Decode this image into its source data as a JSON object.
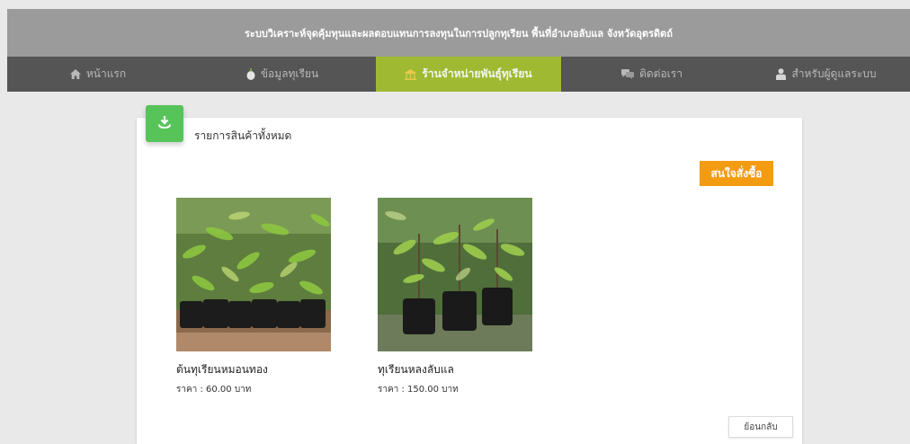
{
  "header": {
    "title": "ระบบวิเคราะห์จุดคุ้มทุนและผลตอบแทนการลงทุนในการปลูกทุเรียน พื้นที่อำเภอลับแล จังหวัดอุตรดิตถ์"
  },
  "nav": {
    "items": [
      {
        "label": "หน้าแรก",
        "icon": "home-icon"
      },
      {
        "label": "ข้อมูลทุเรียน",
        "icon": "durian-icon"
      },
      {
        "label": "ร้านจำหน่ายพันธุ์ทุเรียน",
        "icon": "shop-icon",
        "active": true
      },
      {
        "label": "ติดต่อเรา",
        "icon": "chat-icon"
      },
      {
        "label": "สำหรับผู้ดูแลระบบ",
        "icon": "admin-icon"
      }
    ]
  },
  "card": {
    "title": "รายการสินค้าทั้งหมด",
    "badge_icon": "download-icon",
    "order_label": "สนใจสั่งซื้อ",
    "back_label": "ย้อนกลับ"
  },
  "products": [
    {
      "name": "ต้นทุเรียนหมอนทอง",
      "price": "ราคา : 60.00 บาท",
      "image_icon": "durian-seedlings-photo"
    },
    {
      "name": "ทุเรียนหลงลับแล",
      "price": "ราคา : 150.00 บาท",
      "image_icon": "durian-seedlings-photo"
    }
  ],
  "colors": {
    "header_bg": "#9b9b9b",
    "nav_bg": "#555555",
    "nav_active": "#9fba32",
    "badge": "#56c458",
    "order_button": "#f39c12"
  }
}
